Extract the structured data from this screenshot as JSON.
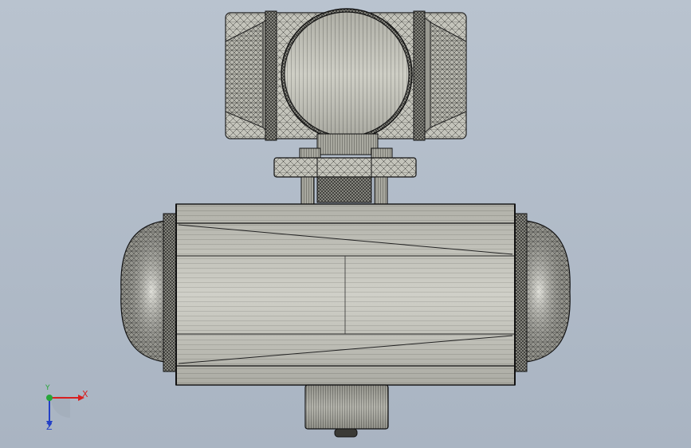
{
  "viewport": {
    "background_top": "#b9c3cf",
    "background_bottom": "#a9b4c2",
    "model_face_color": "#c8c8bf",
    "mesh_line_color": "#1c1c1c"
  },
  "model": {
    "parts": [
      "transmitter-head",
      "neck-flange",
      "sensor-body",
      "end-cap-left",
      "end-cap-right",
      "bottom-fitting"
    ],
    "display_style": "shaded-with-edges"
  },
  "triad": {
    "x_label": "X",
    "y_label": "Y",
    "z_label": "Z",
    "x_color": "#d81f1f",
    "y_color": "#27a63a",
    "z_color": "#2340c6"
  }
}
